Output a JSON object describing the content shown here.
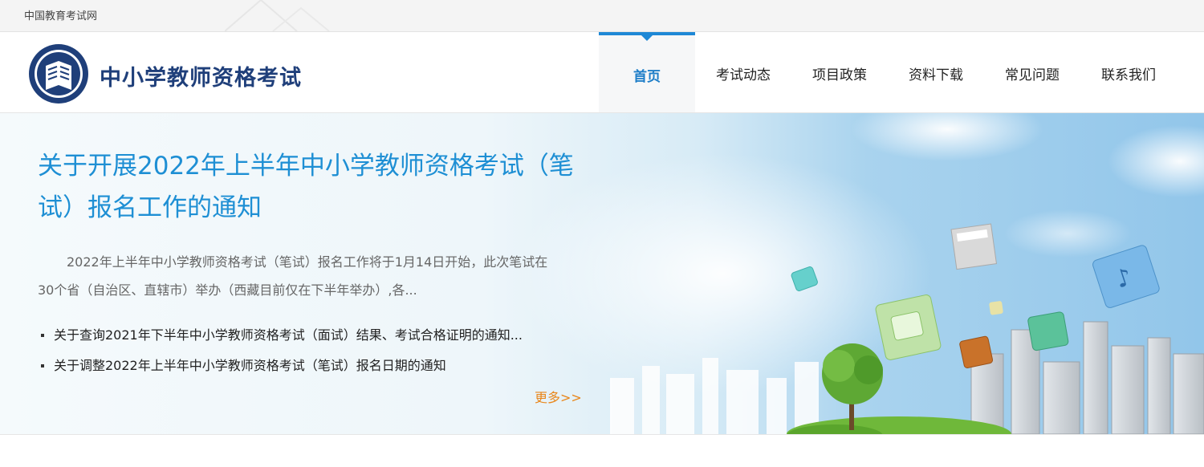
{
  "topbar": {
    "site_link": "中国教育考试网"
  },
  "header": {
    "logo_title": "中小学教师资格考试"
  },
  "nav": {
    "items": [
      {
        "label": "首页",
        "active": true
      },
      {
        "label": "考试动态"
      },
      {
        "label": "项目政策"
      },
      {
        "label": "资料下载"
      },
      {
        "label": "常见问题"
      },
      {
        "label": "联系我们"
      }
    ]
  },
  "banner": {
    "headline": "关于开展2022年上半年中小学教师资格考试（笔试）报名工作的通知",
    "summary": "2022年上半年中小学教师资格考试（笔试）报名工作将于1月14日开始，此次笔试在30个省（自治区、直辖市）举办（西藏目前仅在下半年举办）,各...",
    "news": [
      "关于查询2021年下半年中小学教师资格考试（面试）结果、考试合格证明的通知...",
      "关于调整2022年上半年中小学教师资格考试（笔试）报名日期的通知"
    ],
    "more": "更多>>"
  },
  "colors": {
    "accent": "#1e88d6",
    "headline": "#1e8fd4",
    "more": "#e8861a",
    "logo_text": "#1f3f7a"
  }
}
